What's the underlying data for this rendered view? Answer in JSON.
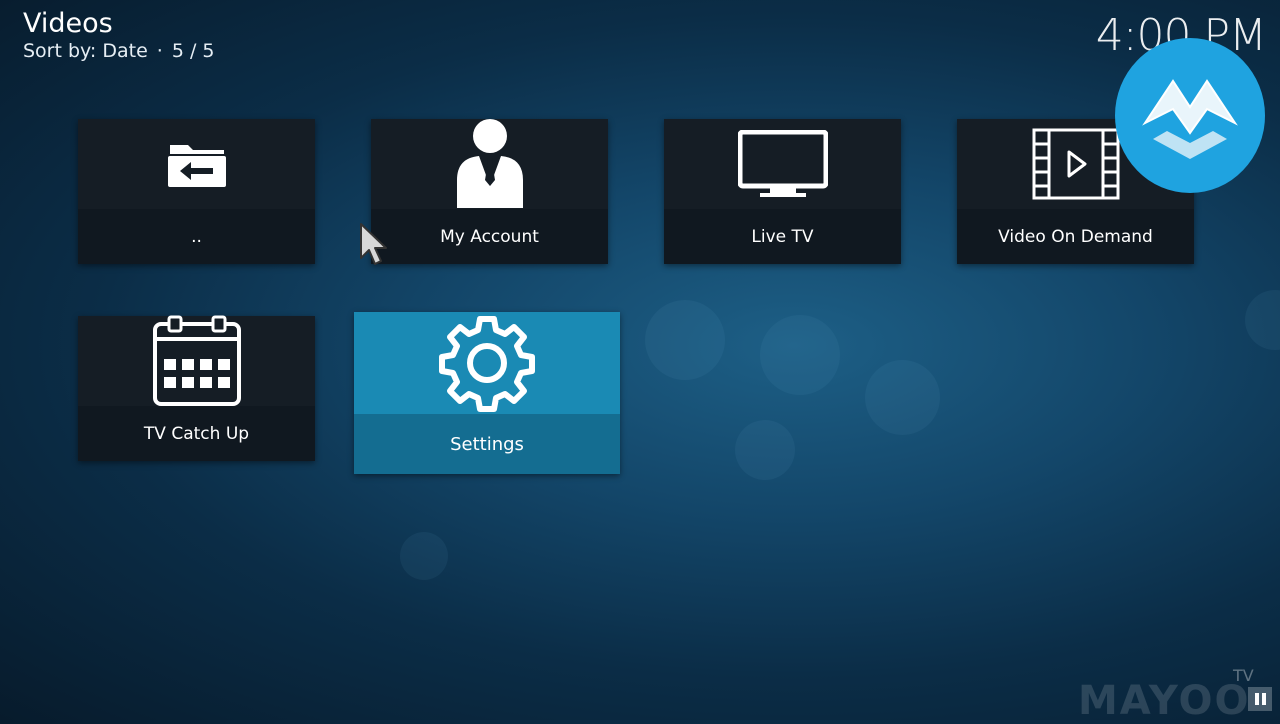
{
  "header": {
    "title": "Videos",
    "sort_label": "Sort by: Date",
    "separator": "·",
    "count": "5 / 5"
  },
  "clock": "4:00 PM",
  "tiles": [
    {
      "label": "..",
      "icon": "folder-back-icon"
    },
    {
      "label": "My Account",
      "icon": "account-person-icon"
    },
    {
      "label": "Live TV",
      "icon": "tv-icon"
    },
    {
      "label": "Video On Demand",
      "icon": "film-play-icon"
    },
    {
      "label": "TV Catch Up",
      "icon": "calendar-icon"
    },
    {
      "label": "Settings",
      "icon": "gear-icon",
      "focused": true
    }
  ],
  "watermark": {
    "text": "MAYOO",
    "suffix": "TV"
  },
  "brand": {
    "icon": "brand-m-logo-icon",
    "color": "#1fa3e0"
  },
  "colors": {
    "focus_tile": "#1a8ab4",
    "tile_bg": "#121a22"
  }
}
